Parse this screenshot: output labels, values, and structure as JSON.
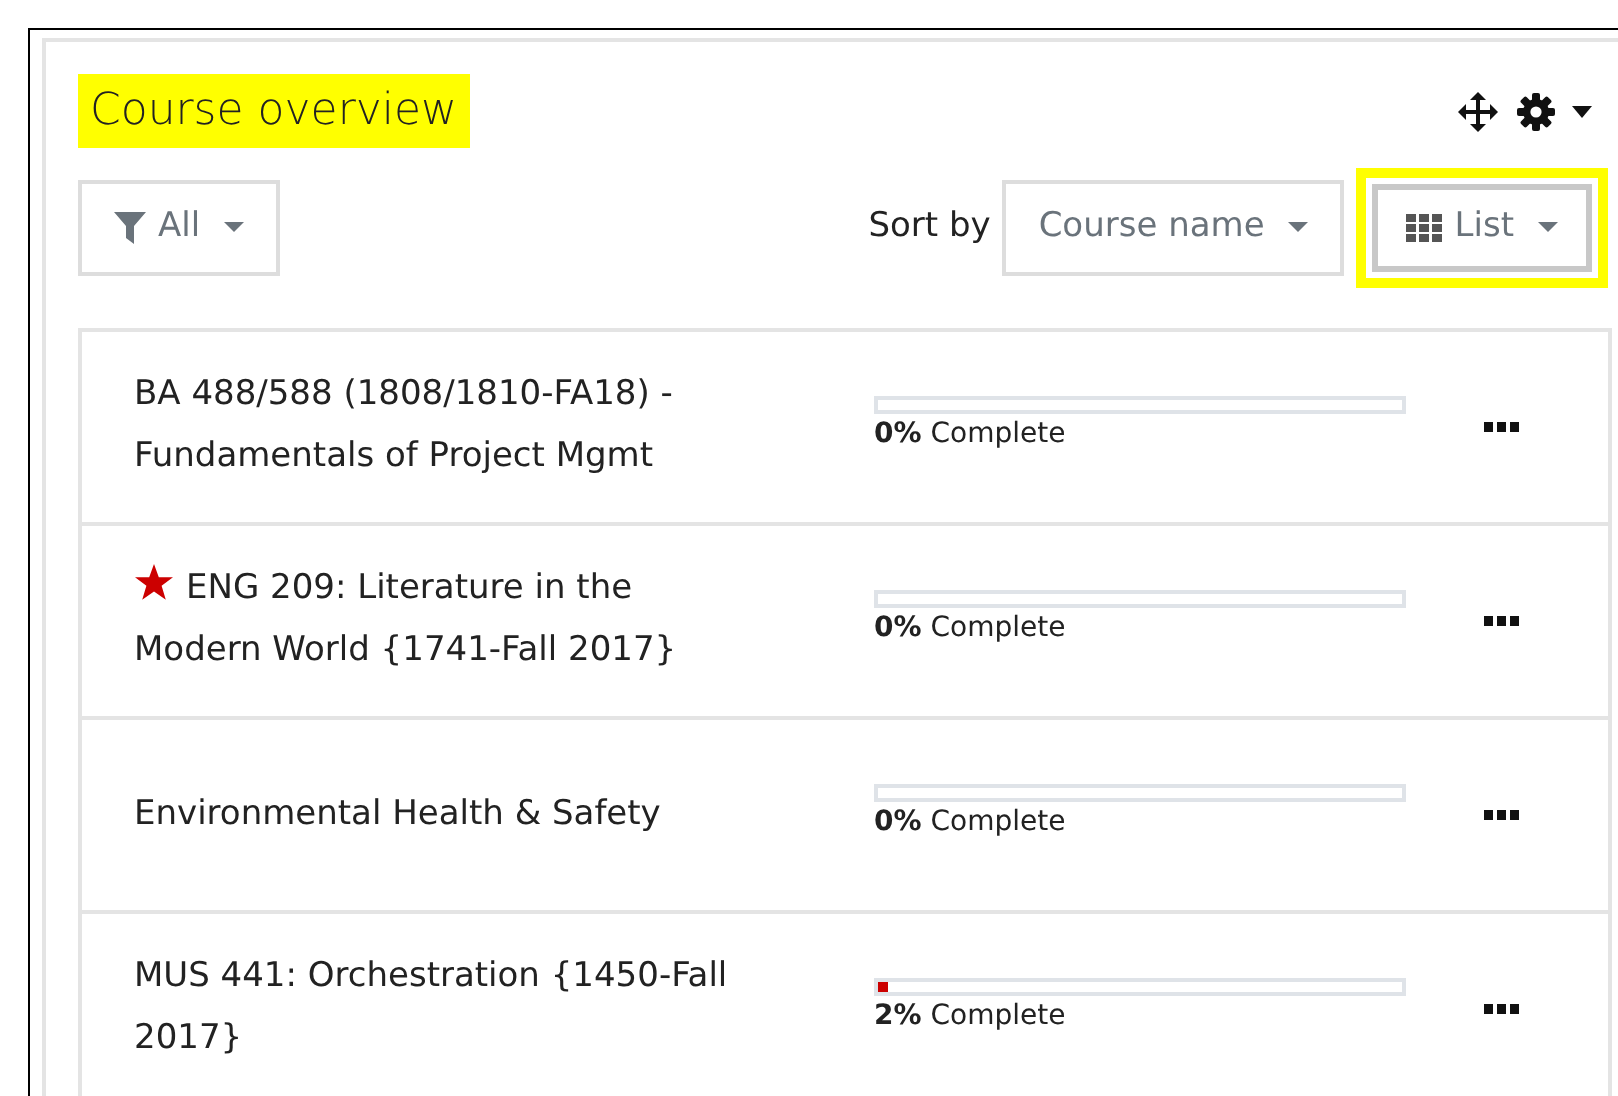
{
  "block": {
    "title": "Course overview",
    "title_highlighted": true
  },
  "controls": {
    "filter": {
      "label": "All"
    },
    "sort_label": "Sort by",
    "sort": {
      "label": "Course name"
    },
    "view": {
      "label": "List",
      "highlighted": true
    }
  },
  "courses": [
    {
      "name": "BA 488/588 (1808/1810-FA18) - Fundamentals of Project Mgmt",
      "starred": false,
      "progress": "**0%** Complete"
    },
    {
      "name": "ENG 209: Literature in the Modern World {1741-Fall 2017}",
      "starred": true,
      "progress": "**0%** Complete"
    },
    {
      "name": "Environmental Health & Safety",
      "starred": false,
      "progress": "**0%** Complete"
    },
    {
      "name": "MUS 441: Orchestration {1450-Fall 2017}",
      "starred": false,
      "level": 0.02,
      "progress": "**2%** Complete"
    }
  ]
}
